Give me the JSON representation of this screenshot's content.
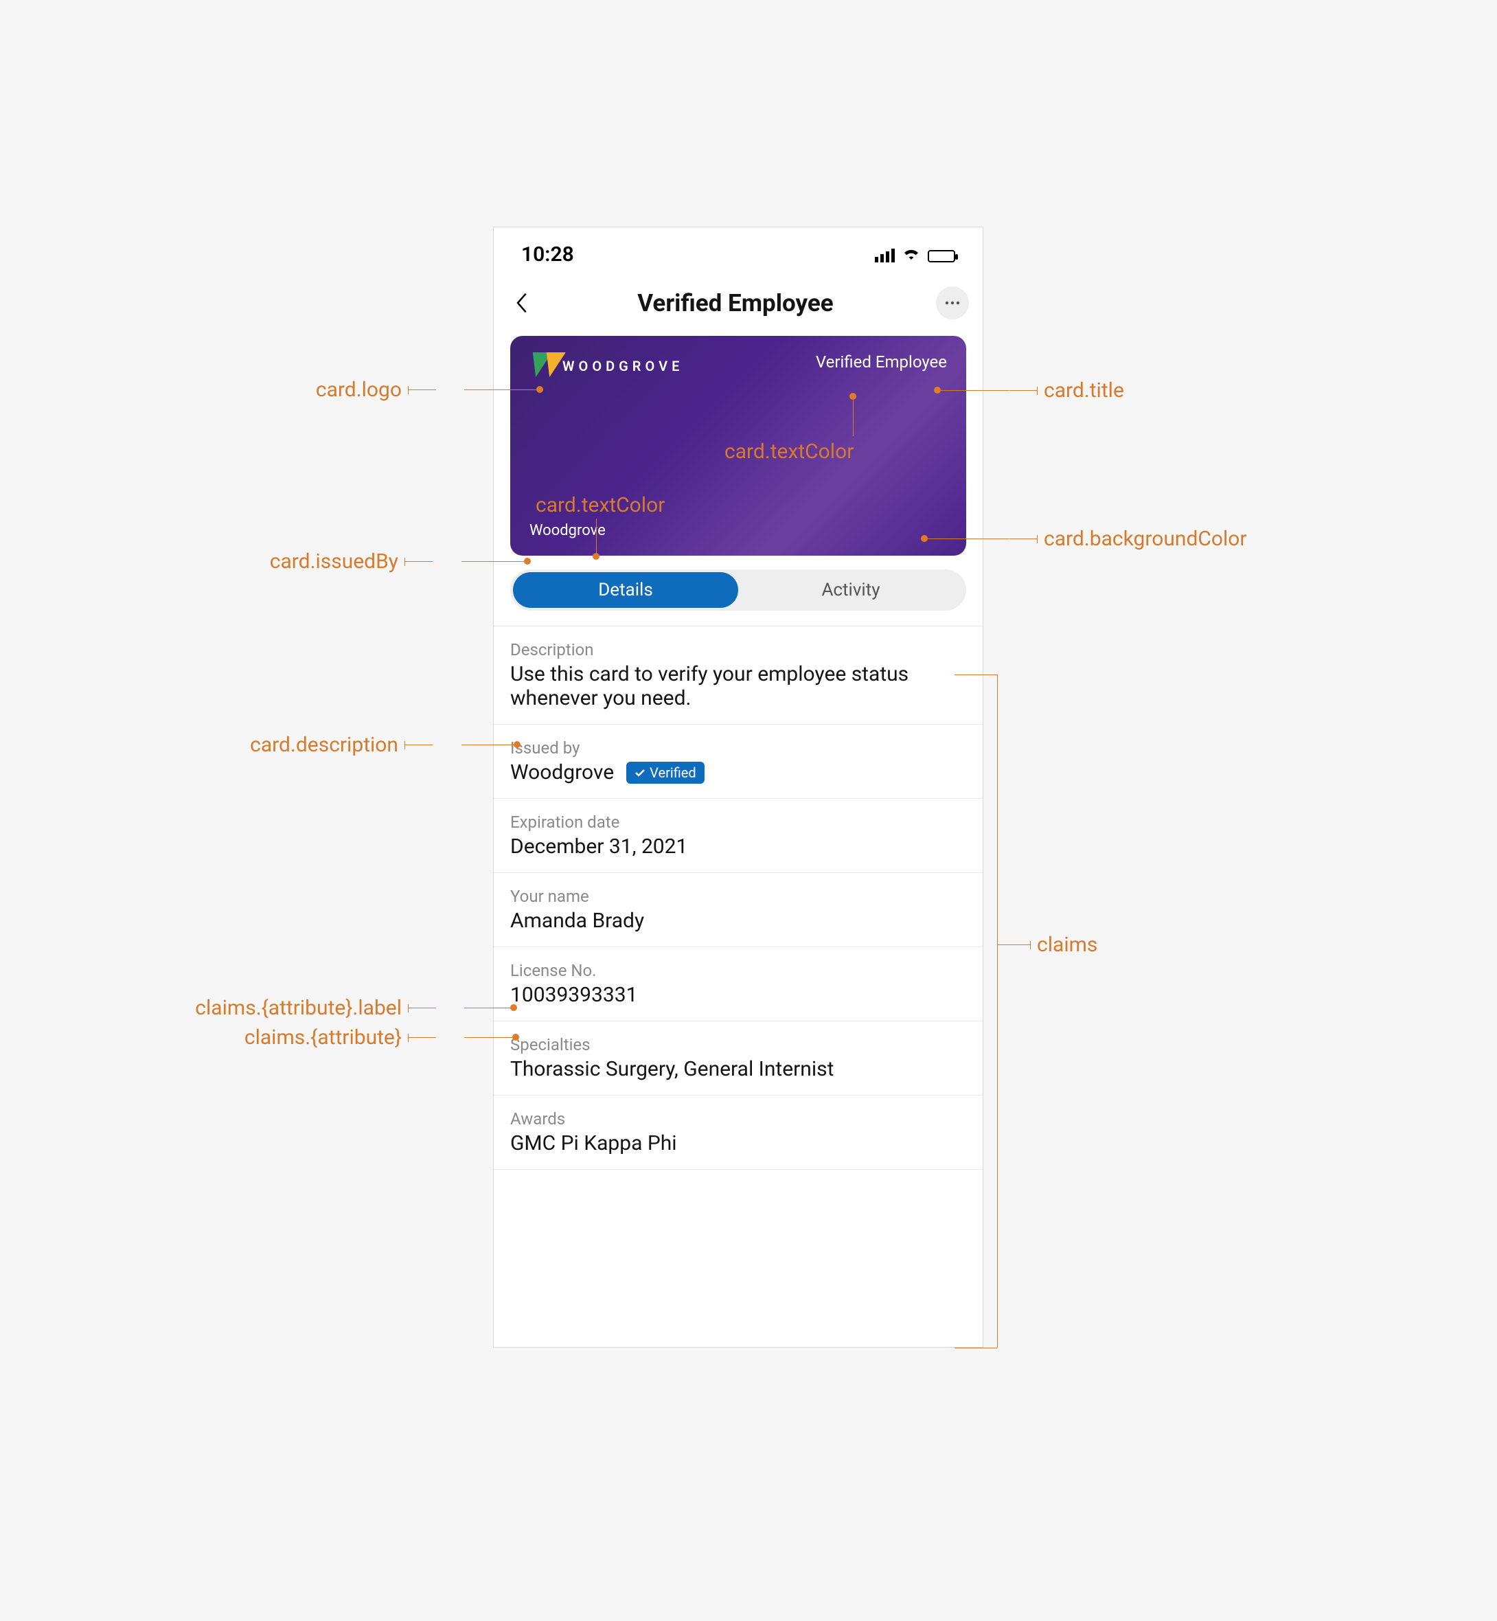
{
  "statusbar": {
    "time": "10:28"
  },
  "nav": {
    "title": "Verified Employee"
  },
  "card": {
    "logoText": "WOODGROVE",
    "title": "Verified Employee",
    "issuedBy": "Woodgrove"
  },
  "tabs": {
    "details": "Details",
    "activity": "Activity"
  },
  "details": {
    "description_label": "Description",
    "description_value": "Use this card to verify your employee status whenever you need.",
    "issuedby_label": "Issued by",
    "issuedby_value": "Woodgrove",
    "verified_badge": "Verified",
    "expiration_label": "Expiration date",
    "expiration_value": "December 31, 2021",
    "name_label": "Your name",
    "name_value": "Amanda Brady",
    "license_label": "License No.",
    "license_value": "10039393331",
    "specialties_label": "Specialties",
    "specialties_value": "Thorassic Surgery, General Internist",
    "awards_label": "Awards",
    "awards_value": "GMC Pi Kappa Phi"
  },
  "annotations": {
    "logo": "card.logo",
    "title": "card.title",
    "textColor1": "card.textColor",
    "textColor2": "card.textColor",
    "issuedBy": "card.issuedBy",
    "bg": "card.backgroundColor",
    "description": "card.description",
    "claims": "claims",
    "attrLabel": "claims.{attribute}.label",
    "attr": "claims.{attribute}"
  }
}
